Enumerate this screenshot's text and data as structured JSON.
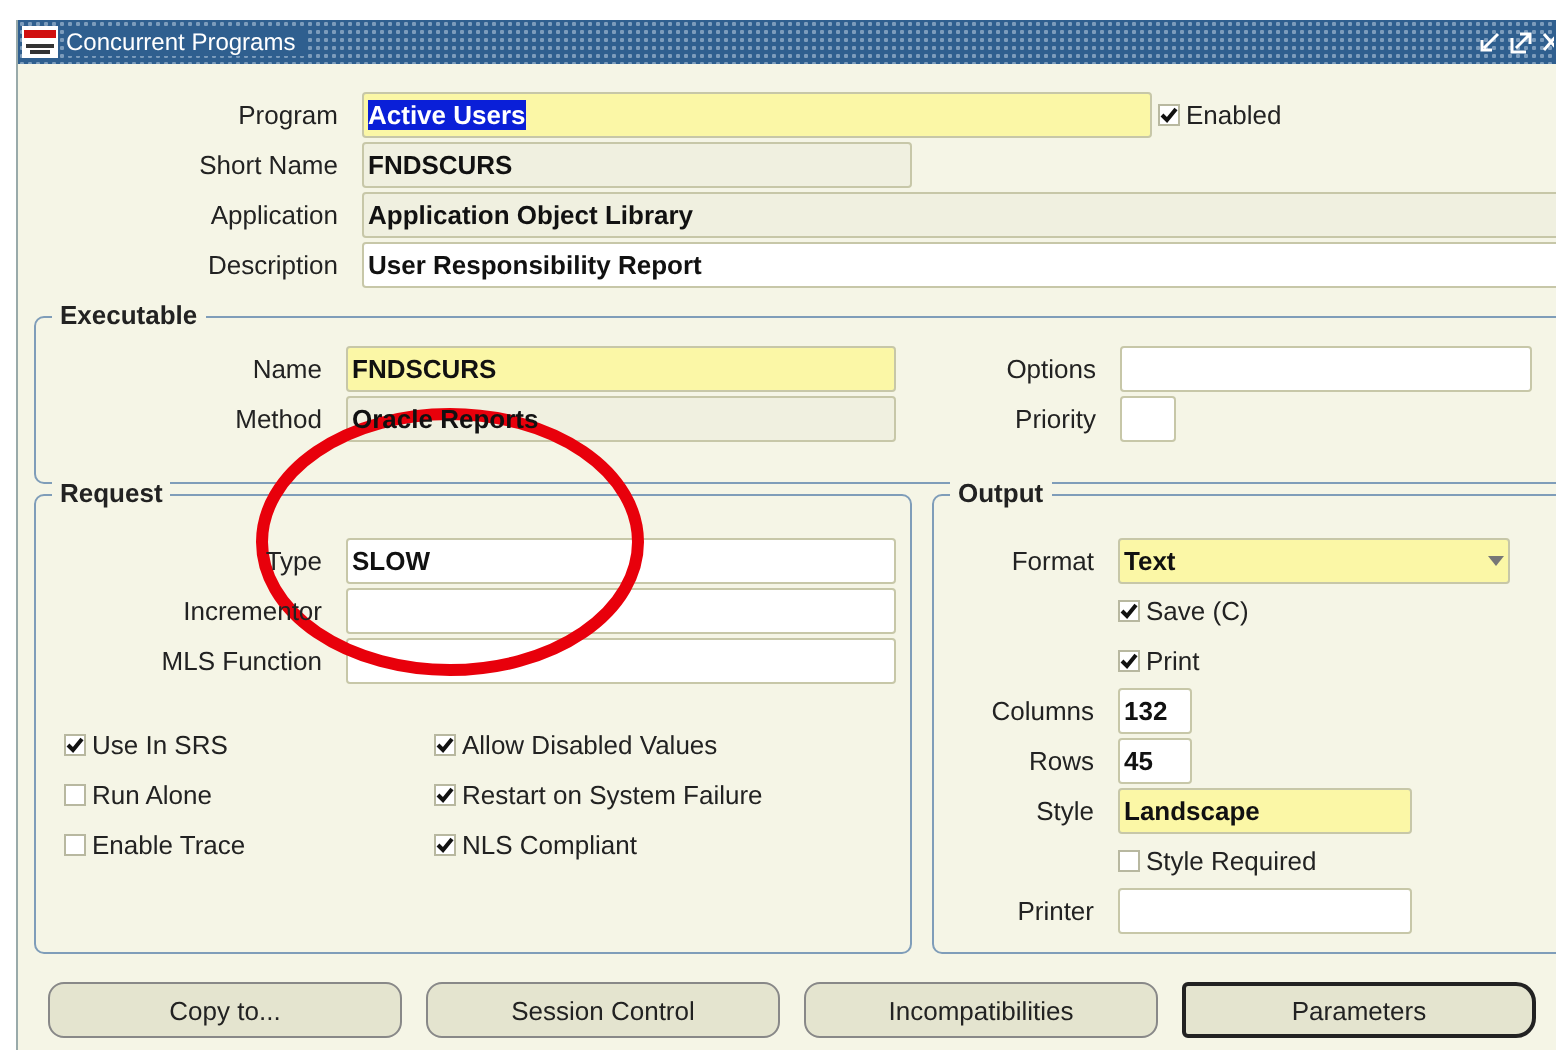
{
  "window": {
    "title": "Concurrent Programs"
  },
  "header": {
    "fields": [
      {
        "label": "Program",
        "value": "Active Users",
        "required": true,
        "readonly": false,
        "highlighted": true
      },
      {
        "label": "Short Name",
        "value": "FNDSCURS",
        "required": false,
        "readonly": true,
        "highlighted": false
      },
      {
        "label": "Application",
        "value": "Application Object Library",
        "required": false,
        "readonly": true,
        "highlighted": false
      },
      {
        "label": "Description",
        "value": "User Responsibility Report",
        "required": false,
        "readonly": false,
        "highlighted": false
      }
    ],
    "enabled": {
      "label": "Enabled",
      "checked": true
    }
  },
  "executable": {
    "title": "Executable",
    "left": [
      {
        "label": "Name",
        "value": "FNDSCURS",
        "required": true,
        "readonly": false
      },
      {
        "label": "Method",
        "value": "Oracle Reports",
        "required": false,
        "readonly": true
      }
    ],
    "right": [
      {
        "label": "Options",
        "required": false,
        "readonly": false
      },
      {
        "label": "Priority",
        "required": false,
        "readonly": false
      }
    ]
  },
  "request": {
    "title": "Request",
    "fields": [
      {
        "label": "Type",
        "value": "SLOW",
        "required": false,
        "readonly": false
      },
      {
        "label": "Incrementor",
        "required": false,
        "readonly": false
      },
      {
        "label": "MLS Function",
        "required": false,
        "readonly": false
      }
    ],
    "checkbox_columns": [
      {
        "items": [
          {
            "label": "Use In SRS",
            "checked": true
          },
          {
            "label": "Run Alone",
            "checked": false
          },
          {
            "label": "Enable Trace",
            "checked": false
          }
        ]
      },
      {
        "items": [
          {
            "label": "Allow Disabled Values",
            "checked": true
          },
          {
            "label": "Restart on System Failure",
            "checked": true
          },
          {
            "label": "NLS Compliant",
            "checked": true
          }
        ]
      }
    ]
  },
  "output": {
    "title": "Output",
    "items": [
      {
        "kind": "dropdown",
        "label": "Format",
        "value": "Text",
        "required": true,
        "readonly": false
      },
      {
        "kind": "checkbox",
        "label": "Save (C)",
        "checked": true
      },
      {
        "kind": "checkbox",
        "label": "Print",
        "checked": true
      },
      {
        "kind": "field",
        "label": "Columns",
        "value": "132",
        "required": false,
        "readonly": false
      },
      {
        "kind": "field",
        "label": "Rows",
        "value": "45",
        "required": false,
        "readonly": false
      },
      {
        "kind": "field",
        "label": "Style",
        "value": "Landscape",
        "required": true,
        "readonly": false
      },
      {
        "kind": "checkbox",
        "label": "Style Required",
        "checked": false
      },
      {
        "kind": "field",
        "label": "Printer",
        "required": false,
        "readonly": false
      }
    ]
  },
  "buttons": [
    {
      "label": "Copy to...",
      "default": false
    },
    {
      "label": "Session Control",
      "default": false
    },
    {
      "label": "Incompatibilities",
      "default": false
    },
    {
      "label": "Parameters",
      "default": true
    }
  ],
  "annotations": [
    {
      "kind": "ellipse"
    }
  ]
}
